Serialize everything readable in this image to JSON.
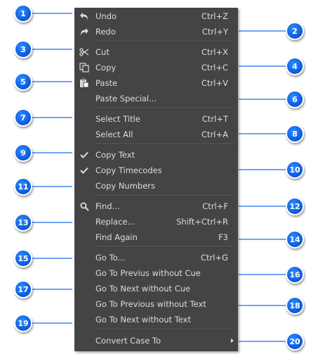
{
  "menu": {
    "items": [
      {
        "label": "Undo",
        "shortcut": "Ctrl+Z",
        "icon": "undo-icon"
      },
      {
        "label": "Redo",
        "shortcut": "Ctrl+Y",
        "icon": "redo-icon"
      },
      {
        "label": "Cut",
        "shortcut": "Ctrl+X",
        "icon": "scissors-icon"
      },
      {
        "label": "Copy",
        "shortcut": "Ctrl+C",
        "icon": "copy-icon"
      },
      {
        "label": "Paste",
        "shortcut": "Ctrl+V",
        "icon": "paste-icon"
      },
      {
        "label": "Paste Special...",
        "shortcut": "",
        "icon": ""
      },
      {
        "label": "Select Title",
        "shortcut": "Ctrl+T",
        "icon": ""
      },
      {
        "label": "Select All",
        "shortcut": "Ctrl+A",
        "icon": ""
      },
      {
        "label": "Copy Text",
        "shortcut": "",
        "icon": "check-icon"
      },
      {
        "label": "Copy Timecodes",
        "shortcut": "",
        "icon": "check-icon"
      },
      {
        "label": "Copy Numbers",
        "shortcut": "",
        "icon": ""
      },
      {
        "label": "Find...",
        "shortcut": "Ctrl+F",
        "icon": "search-icon"
      },
      {
        "label": "Replace...",
        "shortcut": "Shift+Ctrl+R",
        "icon": ""
      },
      {
        "label": "Find Again",
        "shortcut": "F3",
        "icon": ""
      },
      {
        "label": "Go To...",
        "shortcut": "Ctrl+G",
        "icon": ""
      },
      {
        "label": "Go To Previus without Cue",
        "shortcut": "",
        "icon": ""
      },
      {
        "label": "Go To Next without Cue",
        "shortcut": "",
        "icon": ""
      },
      {
        "label": "Go To Previous without Text",
        "shortcut": "",
        "icon": ""
      },
      {
        "label": "Go To Next without Text",
        "shortcut": "",
        "icon": ""
      },
      {
        "label": "Convert Case To",
        "shortcut": "",
        "icon": "chevron-right-icon"
      }
    ]
  },
  "callouts": [
    "1",
    "2",
    "3",
    "4",
    "5",
    "6",
    "7",
    "8",
    "9",
    "10",
    "11",
    "12",
    "13",
    "14",
    "15",
    "16",
    "17",
    "18",
    "19",
    "20"
  ],
  "colors": {
    "menu_background": "#444444",
    "menu_text": "#dcdcdc",
    "callout_fill": "#1a6ff0",
    "callout_border": "#ffffff",
    "leader_line": "#1a6ff0"
  }
}
